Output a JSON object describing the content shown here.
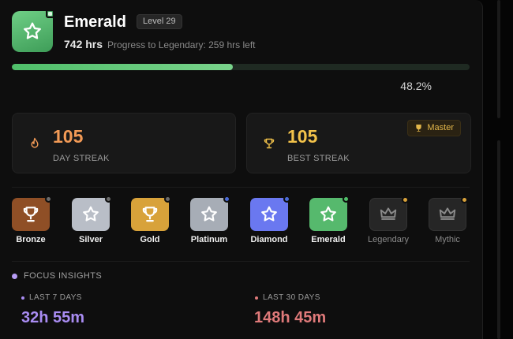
{
  "header": {
    "rank_name": "Emerald",
    "level_label": "Level 29",
    "hours_value": "742 hrs",
    "progress_text": "Progress to Legendary: 259 hrs left",
    "progress_fraction": 0.482,
    "progress_percent_label": "48.2%"
  },
  "stats": {
    "day_streak": {
      "value": "105",
      "label": "DAY STREAK",
      "icon": "flame-icon",
      "color": "#f29a56"
    },
    "best_streak": {
      "value": "105",
      "label": "BEST STREAK",
      "icon": "trophy-icon",
      "color": "#f2c24a",
      "badge_label": "Master"
    }
  },
  "tiers": [
    {
      "name": "Bronze",
      "icon": "trophy-icon",
      "color": "#8f4f26",
      "unlocked": true
    },
    {
      "name": "Silver",
      "icon": "star-icon",
      "color": "#b9bec7",
      "unlocked": true
    },
    {
      "name": "Gold",
      "icon": "trophy-icon",
      "color": "#d8a23a",
      "unlocked": true
    },
    {
      "name": "Platinum",
      "icon": "star-icon",
      "color": "#a7adb6",
      "unlocked": true
    },
    {
      "name": "Diamond",
      "icon": "star-icon",
      "color": "#6a78f0",
      "unlocked": true
    },
    {
      "name": "Emerald",
      "icon": "star-icon",
      "color": "#56b96d",
      "unlocked": true
    },
    {
      "name": "Legendary",
      "icon": "crown-icon",
      "color": "#2a2a2a",
      "unlocked": false
    },
    {
      "name": "Mythic",
      "icon": "crown-icon",
      "color": "#2a2a2a",
      "unlocked": false
    }
  ],
  "insights": {
    "title": "FOCUS INSIGHTS",
    "last7": {
      "label": "LAST 7 DAYS",
      "value": "32h 55m",
      "color": "#a98cf2"
    },
    "last30": {
      "label": "LAST 30 DAYS",
      "value": "148h 45m",
      "color": "#e07a7a"
    }
  }
}
